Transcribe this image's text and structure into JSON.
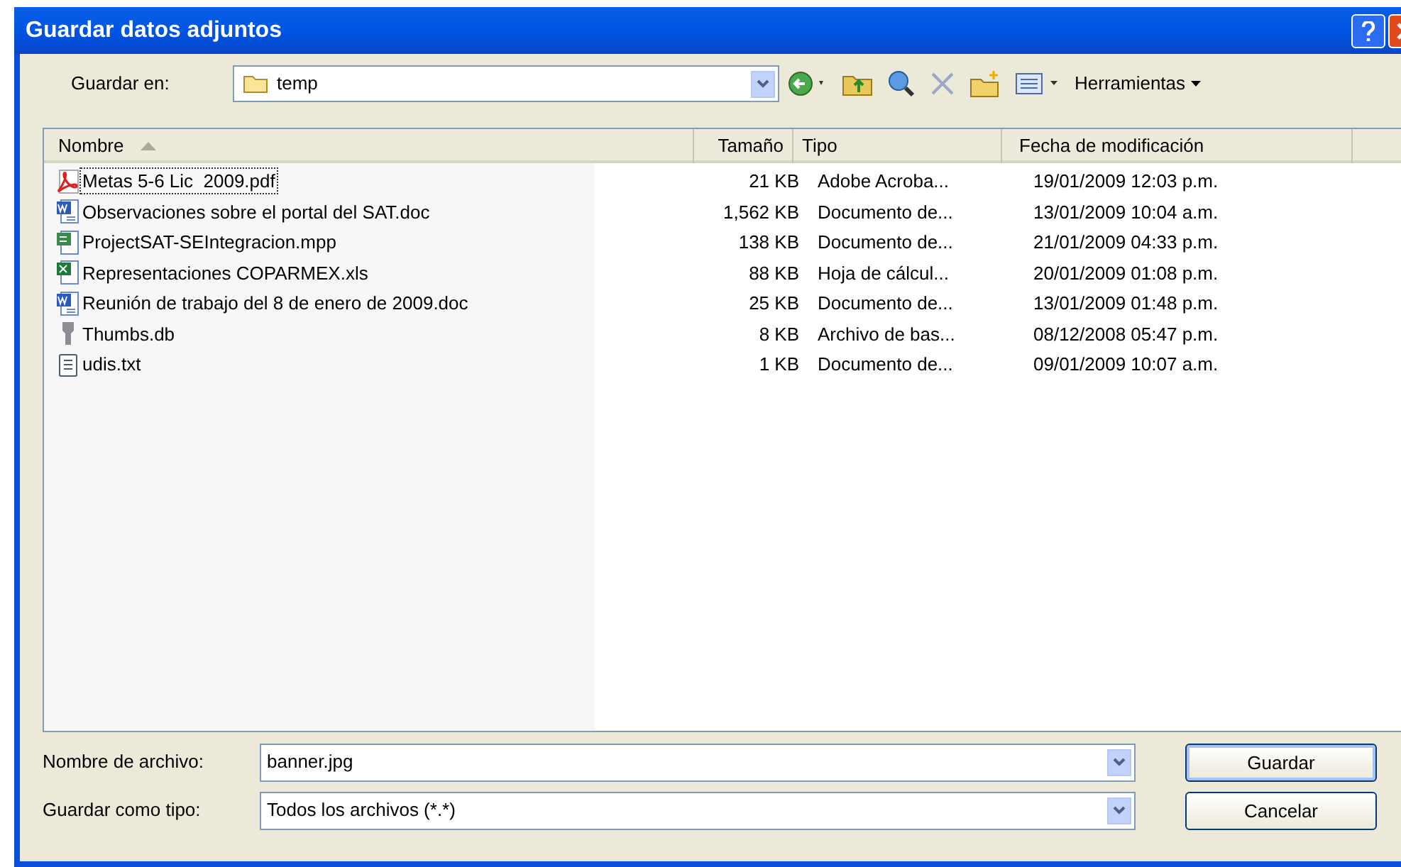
{
  "window": {
    "title": "Guardar datos adjuntos"
  },
  "save_in": {
    "label": "Guardar en:",
    "value": "temp"
  },
  "toolbar": {
    "tools_label": "Herramientas"
  },
  "table": {
    "columns": [
      {
        "label": "Nombre",
        "sorted": true
      },
      {
        "label": "Tamaño",
        "sorted": false
      },
      {
        "label": "Tipo",
        "sorted": false
      },
      {
        "label": "Fecha de modificación",
        "sorted": false
      }
    ],
    "rows": [
      {
        "kind": "pdf",
        "name": "Metas 5-6 Lic  2009.pdf",
        "size": "21 KB",
        "type": "Adobe Acroba...",
        "date": "19/01/2009 12:03 p.m.",
        "focused": true
      },
      {
        "kind": "word",
        "name": "Observaciones sobre el portal del SAT.doc",
        "size": "1,562 KB",
        "type": "Documento de...",
        "date": "13/01/2009 10:04 a.m.",
        "focused": false
      },
      {
        "kind": "project",
        "name": "ProjectSAT-SEIntegracion.mpp",
        "size": "138 KB",
        "type": "Documento de...",
        "date": "21/01/2009 04:33 p.m.",
        "focused": false
      },
      {
        "kind": "excel",
        "name": "Representaciones COPARMEX.xls",
        "size": "88 KB",
        "type": "Hoja de cálcul...",
        "date": "20/01/2009 01:08 p.m.",
        "focused": false
      },
      {
        "kind": "word",
        "name": "Reunión de trabajo del 8 de enero de 2009.doc",
        "size": "25 KB",
        "type": "Documento de...",
        "date": "13/01/2009 01:48 p.m.",
        "focused": false
      },
      {
        "kind": "db",
        "name": "Thumbs.db",
        "size": "8 KB",
        "type": "Archivo de bas...",
        "date": "08/12/2008 05:47 p.m.",
        "focused": false
      },
      {
        "kind": "text",
        "name": "udis.txt",
        "size": "1 KB",
        "type": "Documento de...",
        "date": "09/01/2009 10:07 a.m.",
        "focused": false
      }
    ]
  },
  "file_name": {
    "label": "Nombre de archivo:",
    "value": "banner.jpg"
  },
  "file_type": {
    "label": "Guardar como tipo:",
    "value": "Todos los archivos (*.*)"
  },
  "buttons": [
    "Guardar",
    "Cancelar"
  ]
}
